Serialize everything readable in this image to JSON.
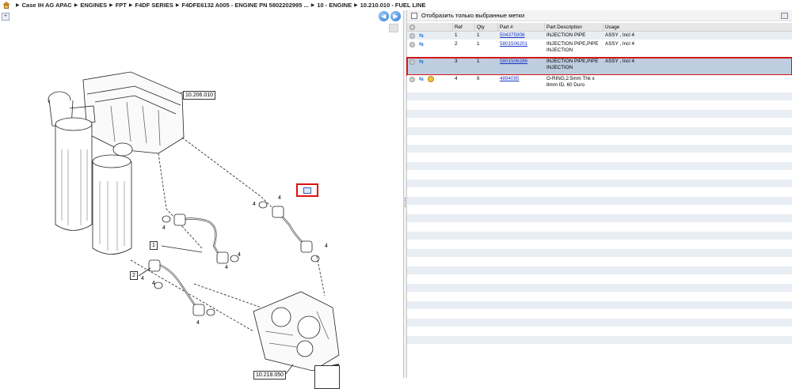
{
  "breadcrumb": {
    "items": [
      "Case IH AG APAC",
      "ENGINES",
      "FPT",
      "F4DF SERIES",
      "F4DFE6132 A005 - ENGINE PN 5802202995 ...",
      "10 - ENGINE",
      "10.210.010 - FUEL LINE"
    ],
    "separator": "▶"
  },
  "diagram": {
    "callouts": [
      "10.206.010",
      "10.218.050",
      "1",
      "2"
    ],
    "numbers": [
      "4",
      "4",
      "4",
      "4",
      "4",
      "4",
      "4",
      "4",
      "4"
    ]
  },
  "filter": {
    "label": "Отобразить только выбранные метки"
  },
  "table": {
    "columns": [
      "Ref",
      "Qty",
      "Part #",
      "Part Description",
      "Usage"
    ],
    "rows": [
      {
        "ref": "1",
        "qty": "1",
        "part": "504375906",
        "desc": "INJECTION PIPE",
        "usage": "ASSY , Incl 4"
      },
      {
        "ref": "2",
        "qty": "1",
        "part": "5801506201",
        "desc": "INJECTION PIPE,PIPE INJECTION",
        "usage": "ASSY , Incl 4"
      },
      {
        "ref": "3",
        "qty": "1",
        "part": "5801506286",
        "desc": "INJECTION PIPE,PIPE INJECTION",
        "usage": "ASSY , Incl 4"
      },
      {
        "ref": "4",
        "qty": "6",
        "part": "4894095",
        "desc": "O-RING,2.5mm Thk x 8mm ID, 60 Duro",
        "usage": ""
      }
    ],
    "selected_ref": "3"
  },
  "icons": {
    "home": "home-icon",
    "nav_prev": "arrow-left-circle-icon",
    "nav_next": "arrow-right-circle-icon",
    "row_status": "grey-dot-icon",
    "row_swap": "swap-arrows-icon",
    "row_kit": "kit-icon"
  },
  "colors": {
    "selected_row_outline": "#d01818",
    "selected_row_bg": "#bfcde0",
    "alt_row_bg": "#e9eef5",
    "link": "#1a36c4",
    "diagram_marker": "#e01010"
  }
}
